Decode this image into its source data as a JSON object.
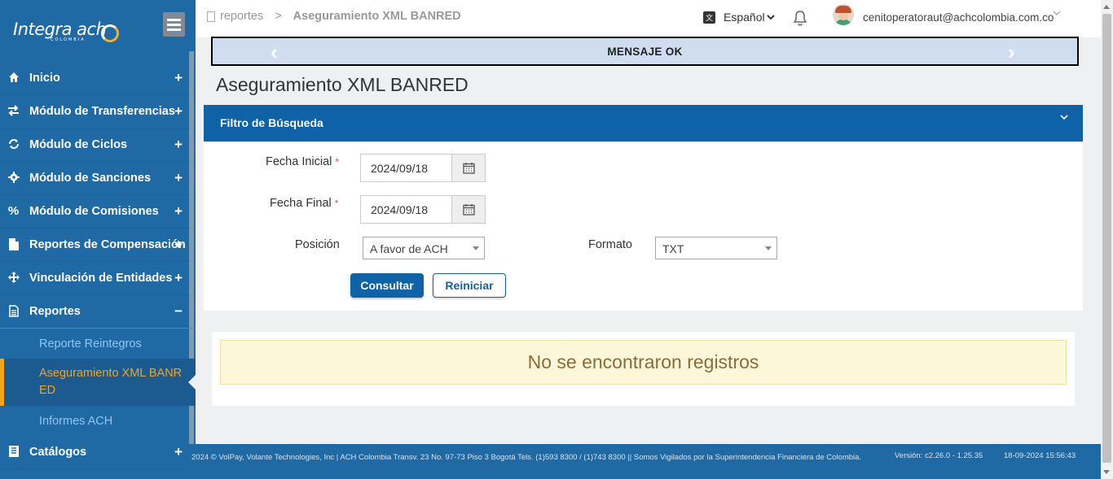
{
  "brand": {
    "name": "Integra ach",
    "sub": "COLOMBIA"
  },
  "sidebar": {
    "items": [
      {
        "label": "Inicio",
        "icon": "home-icon",
        "toggle": "+"
      },
      {
        "label": "Módulo de Transferencias",
        "icon": "exchange-icon",
        "toggle": "+"
      },
      {
        "label": "Módulo de Ciclos",
        "icon": "refresh-icon",
        "toggle": "+"
      },
      {
        "label": "Módulo de Sanciones",
        "icon": "gear-icon",
        "toggle": "+"
      },
      {
        "label": "Módulo de Comisiones",
        "icon": "percent-icon",
        "toggle": "+"
      },
      {
        "label": "Reportes de Compensación",
        "icon": "file-icon",
        "toggle": "+"
      },
      {
        "label": "Vinculación de Entidades",
        "icon": "arrows-icon",
        "toggle": "+"
      },
      {
        "label": "Reportes",
        "icon": "file-text-icon",
        "toggle": "−"
      },
      {
        "label": "Catálogos",
        "icon": "book-icon",
        "toggle": "+"
      }
    ],
    "subitems": [
      {
        "label": "Reporte Reintegros"
      },
      {
        "label": "Aseguramiento XML BANRED"
      },
      {
        "label": "Informes ACH"
      }
    ]
  },
  "header": {
    "breadcrumb_root": "reportes",
    "breadcrumb_sep": ">",
    "breadcrumb_current": "Aseguramiento XML BANRED",
    "language": "Español",
    "user_email": "cenitoperatoraut@achcolombia.com.co"
  },
  "message": {
    "text": "MENSAJE OK"
  },
  "page": {
    "title": "Aseguramiento XML BANRED"
  },
  "filter": {
    "title": "Filtro de Búsqueda",
    "fecha_inicial_label": "Fecha Inicial",
    "fecha_inicial_value": "2024/09/18",
    "fecha_final_label": "Fecha Final",
    "fecha_final_value": "2024/09/18",
    "required_mark": "*",
    "posicion_label": "Posición",
    "posicion_value": "A favor de ACH",
    "formato_label": "Formato",
    "formato_value": "TXT",
    "consultar_label": "Consultar",
    "reiniciar_label": "Reiniciar"
  },
  "results": {
    "empty_text": "No se encontraron registros"
  },
  "footer": {
    "copyright": "2024 © VolPay, Volante Technologies, Inc | ACH Colombia Transv. 23 No. 97-73 Piso 3 Bogotá Tels. (1)593 8300 / (1)743 8300 || Somos Vigilados por la Superintendencia Financiera de Colombia.",
    "version": "Versión: c2.26.0 - 1.25.35",
    "timestamp": "18-09-2024 15:56:43"
  },
  "colors": {
    "sidebar": "#1f6aa5",
    "primary": "#0e62a8",
    "active": "#f7a21b",
    "message_bg": "#d0dcf0",
    "empty_bg": "#fcf7d8"
  }
}
